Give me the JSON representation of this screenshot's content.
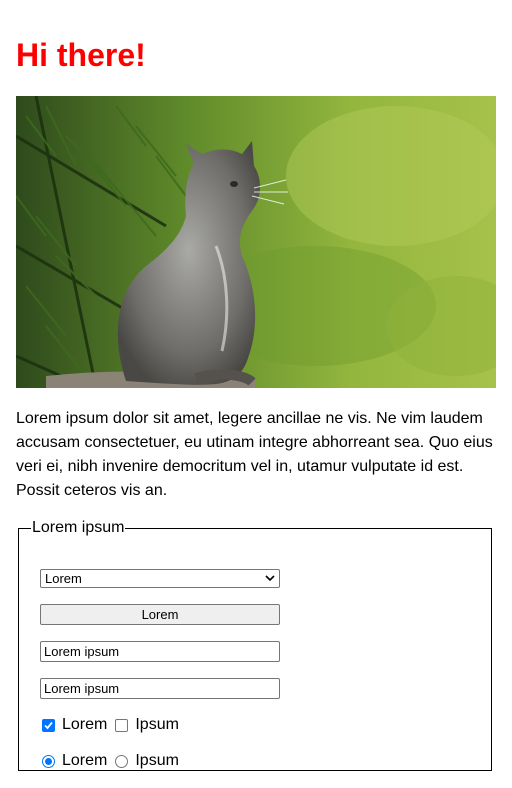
{
  "heading": "Hi there!",
  "heading_color": "#ff0000",
  "image": {
    "subject": "kitten-photo",
    "alt": "Grey kitten sitting on a rock looking up, green foliage background"
  },
  "paragraph": "Lorem ipsum dolor sit amet, legere ancillae ne vis. Ne vim laudem accusam consectetuer, eu utinam integre abhorreant sea. Quo eius veri ei, nibh invenire democritum vel in, utamur vulputate id est. Possit ceteros vis an.",
  "form": {
    "legend": "Lorem ipsum",
    "select": {
      "selected": "Lorem"
    },
    "button": {
      "label": "Lorem"
    },
    "input1": {
      "value": "Lorem ipsum"
    },
    "input2": {
      "value": "Lorem ipsum"
    },
    "checkboxes": [
      {
        "label": "Lorem",
        "checked": true
      },
      {
        "label": "Ipsum",
        "checked": false
      }
    ],
    "radios": [
      {
        "label": "Lorem",
        "selected": true
      },
      {
        "label": "Ipsum",
        "selected": false
      }
    ]
  },
  "colors": {
    "accent": "#0075ff",
    "control_border": "#767676",
    "button_bg": "#efefef"
  }
}
